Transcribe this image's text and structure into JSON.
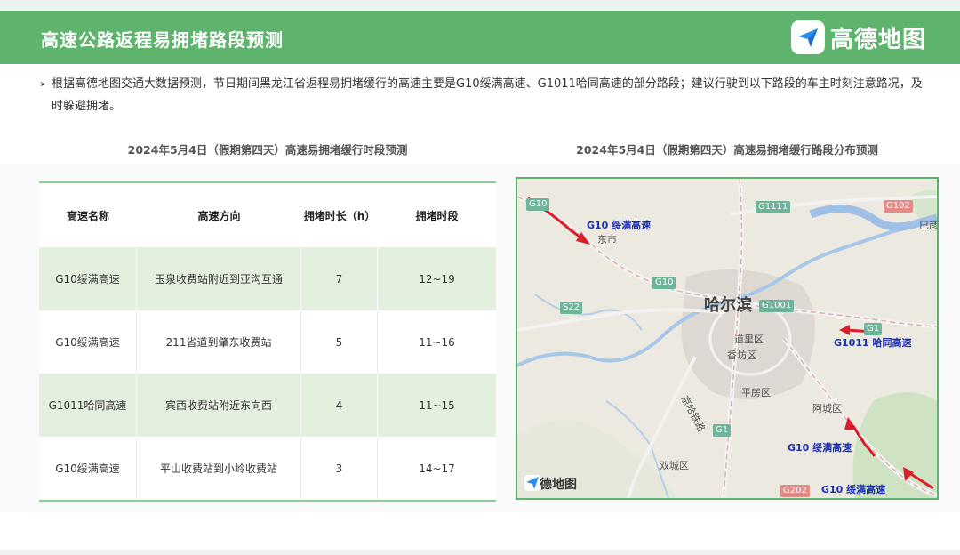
{
  "header": {
    "title": "高速公路返程易拥堵路段预测",
    "brand": "高德地图",
    "color": "#5fb46d"
  },
  "intro": {
    "bullet": "➢",
    "text": "根据高德地图交通大数据预测，节日期间黑龙江省返程易拥堵缓行的高速主要是G10绥满高速、G1011哈同高速的部分路段；建议行驶到以下路段的车主时刻注意路况，及时躲避拥堵。"
  },
  "table": {
    "title": "2024年5月4日（假期第四天）高速易拥堵缓行时段预测",
    "headers": [
      "高速名称",
      "高速方向",
      "拥堵时长（h）",
      "拥堵时段"
    ],
    "rows": [
      [
        "G10绥满高速",
        "玉泉收费站附近到亚沟互通",
        "7",
        "12~19"
      ],
      [
        "G10绥满高速",
        "211省道到肇东收费站",
        "5",
        "11~16"
      ],
      [
        "G1011哈同高速",
        "宾西收费站附近东向西",
        "4",
        "11~15"
      ],
      [
        "G10绥满高速",
        "平山收费站到小岭收费站",
        "3",
        "14~17"
      ]
    ]
  },
  "map": {
    "title": "2024年5月4日（假期第四天）高速易拥堵缓行路段分布预测",
    "callouts": [
      "G10 绥满高速",
      "G1011 哈同高速",
      "G10 绥满高速",
      "G10 绥满高速"
    ],
    "city": "哈尔滨",
    "places": [
      "东市",
      "道里区",
      "香坊区",
      "平房区",
      "阿城区",
      "双城区",
      "京哈铁路",
      "巴彦"
    ],
    "shields": [
      "G10",
      "G1111",
      "G102",
      "G10",
      "S22",
      "G1001",
      "G1",
      "G202",
      "G1"
    ],
    "brand": "高德地图",
    "congestion_color": "#d81e2a"
  }
}
